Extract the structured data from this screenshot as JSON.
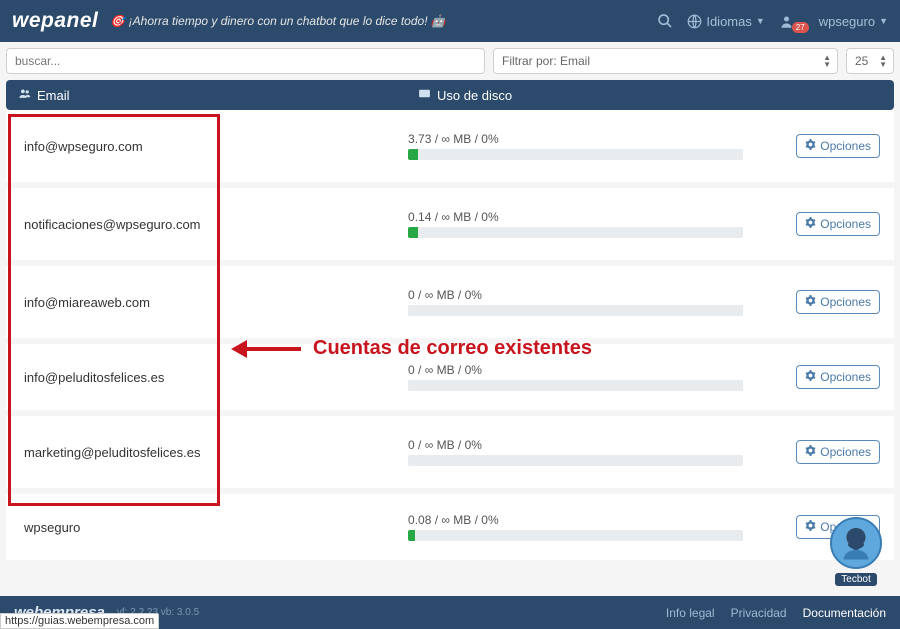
{
  "topbar": {
    "logo": "wepanel",
    "promo_prefix": "🎯",
    "promo": "¡Ahorra tiempo y dinero con un chatbot que lo dice todo!",
    "promo_suffix": "🤖",
    "idiomas_label": "Idiomas",
    "username": "wpseguro",
    "notif_count": "27"
  },
  "controls": {
    "search_placeholder": "buscar...",
    "filter_label": "Filtrar por: Email",
    "page_size": "25"
  },
  "table": {
    "col_email": "Email",
    "col_disk": "Uso de disco"
  },
  "rows": [
    {
      "email": "info@wpseguro.com",
      "disk_text": "3.73 / ∞ MB / 0%",
      "opt": "Opciones",
      "fill": 3
    },
    {
      "email": "notificaciones@wpseguro.com",
      "disk_text": "0.14 / ∞ MB / 0%",
      "opt": "Opciones",
      "fill": 3
    },
    {
      "email": "info@miareaweb.com",
      "disk_text": "0 / ∞ MB / 0%",
      "opt": "Opciones",
      "fill": 0
    },
    {
      "email": "info@peluditosfelices.es",
      "disk_text": "0 / ∞ MB / 0%",
      "opt": "Opciones",
      "fill": 0
    },
    {
      "email": "marketing@peluditosfelices.es",
      "disk_text": "0 / ∞ MB / 0%",
      "opt": "Opciones",
      "fill": 0
    },
    {
      "email": "wpseguro",
      "disk_text": "0.08 / ∞ MB / 0%",
      "opt": "Opciones",
      "fill": 2
    }
  ],
  "annotation": {
    "text": "Cuentas de correo existentes"
  },
  "footer": {
    "brand": "webempresa",
    "version": "vf: 2.2.23 vb: 3.0.5",
    "links": {
      "legal": "Info legal",
      "privacy": "Privacidad",
      "docs": "Documentación"
    }
  },
  "bot": {
    "label": "Tecbot"
  },
  "status_url": "https://guias.webempresa.com"
}
